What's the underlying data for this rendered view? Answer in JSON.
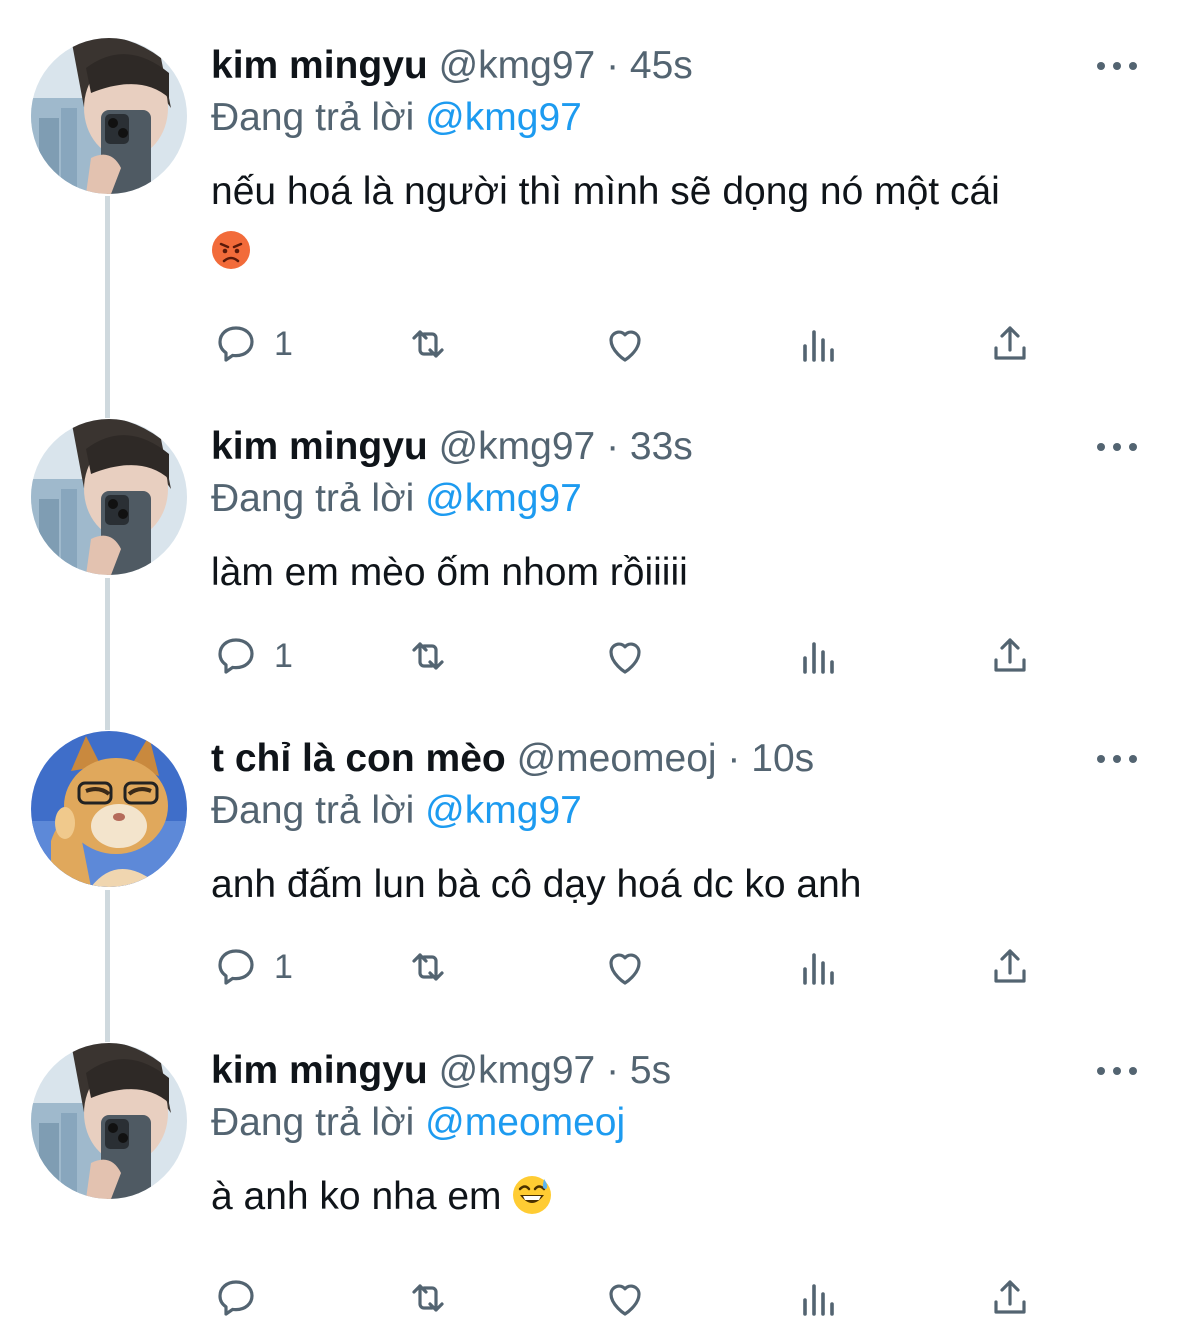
{
  "tweets": [
    {
      "display_name": "kim mingyu",
      "handle": "@kmg97",
      "dot": "·",
      "time": "45s",
      "reply_prefix": "Đang trả lời",
      "reply_to": "@kmg97",
      "text": "nếu hoá là người thì mình sẽ dọng nó một cái",
      "emoji": "angry-face",
      "reply_count": "1",
      "avatar": "person-avatar"
    },
    {
      "display_name": "kim mingyu",
      "handle": "@kmg97",
      "dot": "·",
      "time": "33s",
      "reply_prefix": "Đang trả lời",
      "reply_to": "@kmg97",
      "text": "làm em mèo ốm nhom rồiiiii",
      "reply_count": "1",
      "avatar": "person-avatar"
    },
    {
      "display_name": "t chỉ là con mèo",
      "handle": "@meomeoj",
      "dot": "·",
      "time": "10s",
      "reply_prefix": "Đang trả lời",
      "reply_to": "@kmg97",
      "text": "anh đấm lun bà cô dạy hoá dc ko anh",
      "reply_count": "1",
      "avatar": "cat-avatar"
    },
    {
      "display_name": "kim mingyu",
      "handle": "@kmg97",
      "dot": "·",
      "time": "5s",
      "reply_prefix": "Đang trả lời",
      "reply_to": "@meomeoj",
      "text": "à anh ko nha em",
      "emoji": "grinning-sweat-face",
      "reply_count": "",
      "avatar": "person-avatar"
    }
  ],
  "icons": {
    "reply": "reply-icon",
    "retweet": "retweet-icon",
    "like": "heart-icon",
    "views": "analytics-icon",
    "share": "share-icon",
    "more": "more-icon"
  },
  "colors": {
    "text": "#0f1419",
    "secondary": "#536471",
    "link": "#1d9bf0",
    "thread_line": "#cfd9de"
  }
}
